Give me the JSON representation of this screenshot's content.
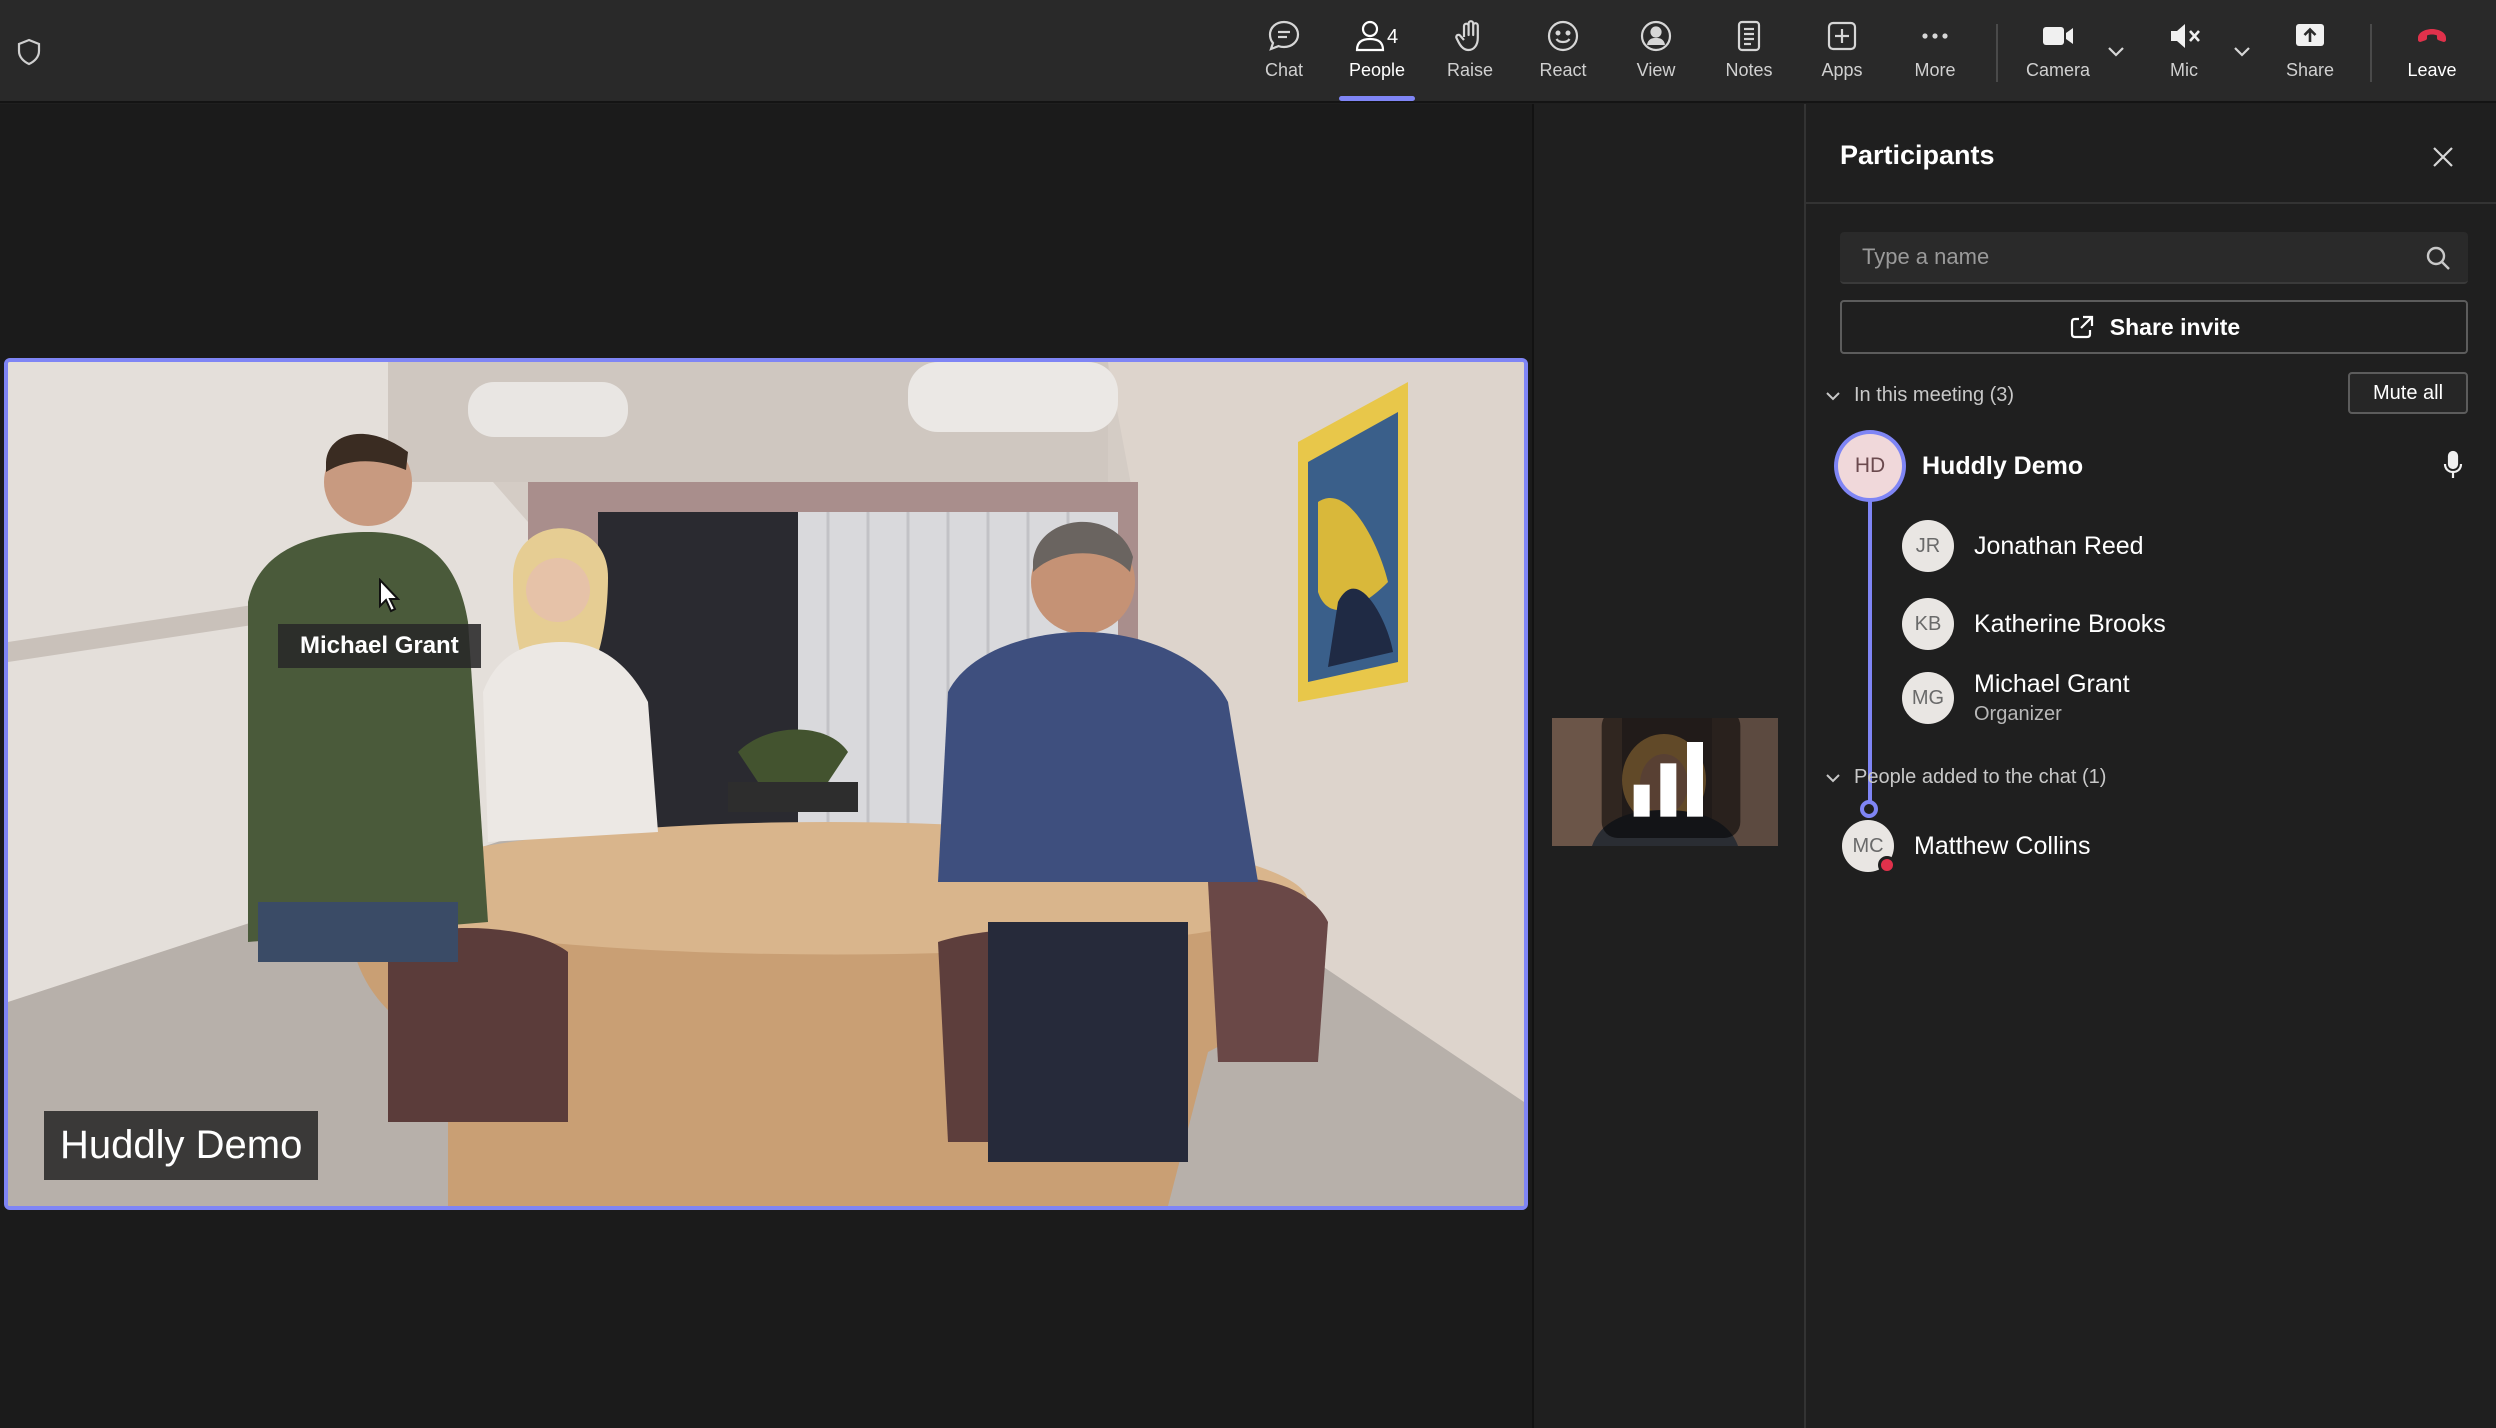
{
  "toolbar": {
    "chat": "Chat",
    "people": "People",
    "people_count": "4",
    "raise": "Raise",
    "react": "React",
    "view": "View",
    "notes": "Notes",
    "apps": "Apps",
    "more": "More",
    "camera": "Camera",
    "mic": "Mic",
    "share": "Share",
    "leave": "Leave"
  },
  "stage": {
    "main_speaker": "Huddly Demo",
    "hover_name": "Michael Grant"
  },
  "participants": {
    "title": "Participants",
    "search_placeholder": "Type a name",
    "share_invite": "Share invite",
    "in_meeting_label": "In this meeting (3)",
    "mute_all": "Mute all",
    "host": {
      "initials": "HD",
      "name": "Huddly Demo"
    },
    "members": [
      {
        "initials": "JR",
        "name": "Jonathan Reed",
        "role": ""
      },
      {
        "initials": "KB",
        "name": "Katherine Brooks",
        "role": ""
      },
      {
        "initials": "MG",
        "name": "Michael Grant",
        "role": "Organizer"
      }
    ],
    "chat_added_label": "People added to the chat (1)",
    "chat_added": [
      {
        "initials": "MC",
        "name": "Matthew Collins"
      }
    ]
  },
  "colors": {
    "accent": "#7f85f5",
    "leave_red": "#e0314b",
    "background": "#1f1f1f",
    "toolbar": "#292929"
  },
  "icons": [
    "shield-icon",
    "chat-icon",
    "people-icon",
    "raise-hand-icon",
    "react-icon",
    "view-icon",
    "notes-icon",
    "apps-icon",
    "more-icon",
    "camera-icon",
    "mic-muted-icon",
    "share-icon",
    "leave-phone-icon",
    "close-icon",
    "search-icon",
    "share-invite-icon",
    "chevron-down-icon",
    "mic-icon"
  ]
}
